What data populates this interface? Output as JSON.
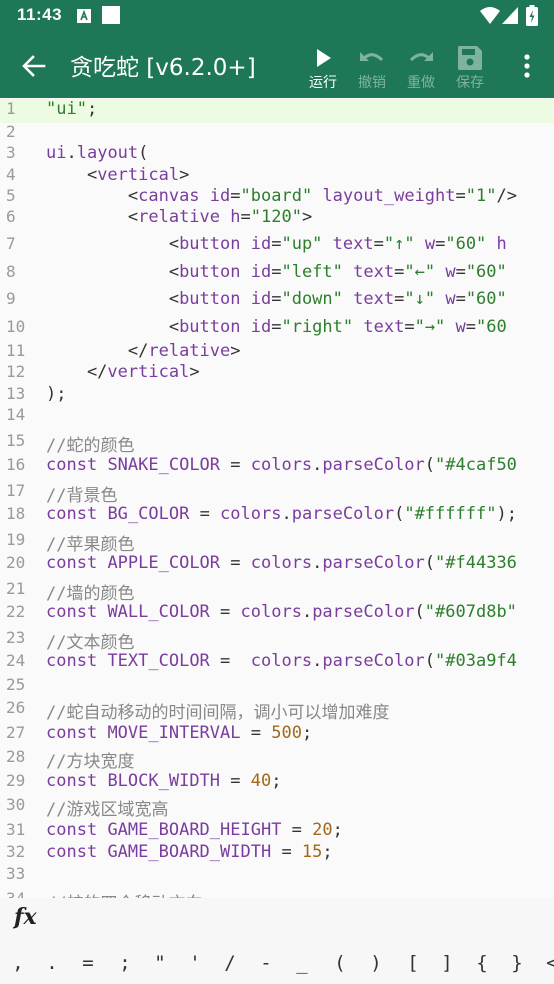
{
  "statusbar": {
    "time": "11:43"
  },
  "toolbar": {
    "title": "贪吃蛇 [v6.2.0+]",
    "run_label": "运行",
    "undo_label": "撤销",
    "redo_label": "重做",
    "save_label": "保存"
  },
  "editor": {
    "lines": [
      {
        "n": "1",
        "t": [
          [
            "s",
            "\"ui\""
          ],
          [
            "p",
            ";"
          ]
        ]
      },
      {
        "n": "2",
        "t": []
      },
      {
        "n": "3",
        "t": [
          [
            "m",
            "ui"
          ],
          [
            "p",
            "."
          ],
          [
            "m",
            "layout"
          ],
          [
            "p",
            "("
          ]
        ]
      },
      {
        "n": "4",
        "t": [
          [
            "p",
            "    <"
          ],
          [
            "k",
            "vertical"
          ],
          [
            "p",
            ">"
          ]
        ]
      },
      {
        "n": "5",
        "t": [
          [
            "p",
            "        <"
          ],
          [
            "k",
            "canvas"
          ],
          [
            "p",
            " "
          ],
          [
            "m",
            "id"
          ],
          [
            "p",
            "="
          ],
          [
            "s",
            "\"board\""
          ],
          [
            "p",
            " "
          ],
          [
            "m",
            "layout_weight"
          ],
          [
            "p",
            "="
          ],
          [
            "s",
            "\"1\""
          ],
          [
            "p",
            "/>"
          ]
        ]
      },
      {
        "n": "6",
        "t": [
          [
            "p",
            "        <"
          ],
          [
            "k",
            "relative"
          ],
          [
            "p",
            " "
          ],
          [
            "m",
            "h"
          ],
          [
            "p",
            "="
          ],
          [
            "s",
            "\"120\""
          ],
          [
            "p",
            ">"
          ]
        ]
      },
      {
        "n": "7",
        "t": [
          [
            "p",
            "            <"
          ],
          [
            "k",
            "button"
          ],
          [
            "p",
            " "
          ],
          [
            "m",
            "id"
          ],
          [
            "p",
            "="
          ],
          [
            "s",
            "\"up\""
          ],
          [
            "p",
            " "
          ],
          [
            "m",
            "text"
          ],
          [
            "p",
            "="
          ],
          [
            "s",
            "\"↑\""
          ],
          [
            "p",
            " "
          ],
          [
            "m",
            "w"
          ],
          [
            "p",
            "="
          ],
          [
            "s",
            "\"60\""
          ],
          [
            "p",
            " "
          ],
          [
            "m",
            "h"
          ]
        ]
      },
      {
        "n": "8",
        "t": [
          [
            "p",
            "            <"
          ],
          [
            "k",
            "button"
          ],
          [
            "p",
            " "
          ],
          [
            "m",
            "id"
          ],
          [
            "p",
            "="
          ],
          [
            "s",
            "\"left\""
          ],
          [
            "p",
            " "
          ],
          [
            "m",
            "text"
          ],
          [
            "p",
            "="
          ],
          [
            "s",
            "\"←\""
          ],
          [
            "p",
            " "
          ],
          [
            "m",
            "w"
          ],
          [
            "p",
            "="
          ],
          [
            "s",
            "\"60\""
          ]
        ]
      },
      {
        "n": "9",
        "t": [
          [
            "p",
            "            <"
          ],
          [
            "k",
            "button"
          ],
          [
            "p",
            " "
          ],
          [
            "m",
            "id"
          ],
          [
            "p",
            "="
          ],
          [
            "s",
            "\"down\""
          ],
          [
            "p",
            " "
          ],
          [
            "m",
            "text"
          ],
          [
            "p",
            "="
          ],
          [
            "s",
            "\"↓\""
          ],
          [
            "p",
            " "
          ],
          [
            "m",
            "w"
          ],
          [
            "p",
            "="
          ],
          [
            "s",
            "\"60\""
          ]
        ]
      },
      {
        "n": "10",
        "t": [
          [
            "p",
            "            <"
          ],
          [
            "k",
            "button"
          ],
          [
            "p",
            " "
          ],
          [
            "m",
            "id"
          ],
          [
            "p",
            "="
          ],
          [
            "s",
            "\"right\""
          ],
          [
            "p",
            " "
          ],
          [
            "m",
            "text"
          ],
          [
            "p",
            "="
          ],
          [
            "s",
            "\"→\""
          ],
          [
            "p",
            " "
          ],
          [
            "m",
            "w"
          ],
          [
            "p",
            "="
          ],
          [
            "s",
            "\"60"
          ]
        ]
      },
      {
        "n": "11",
        "t": [
          [
            "p",
            "        </"
          ],
          [
            "k",
            "relative"
          ],
          [
            "p",
            ">"
          ]
        ]
      },
      {
        "n": "12",
        "t": [
          [
            "p",
            "    </"
          ],
          [
            "k",
            "vertical"
          ],
          [
            "p",
            ">"
          ]
        ]
      },
      {
        "n": "13",
        "t": [
          [
            "p",
            ");"
          ]
        ]
      },
      {
        "n": "14",
        "t": []
      },
      {
        "n": "15",
        "t": [
          [
            "c",
            "//蛇的颜色"
          ]
        ]
      },
      {
        "n": "16",
        "t": [
          [
            "k",
            "const"
          ],
          [
            "p",
            " "
          ],
          [
            "m",
            "SNAKE_COLOR"
          ],
          [
            "p",
            " = "
          ],
          [
            "m",
            "colors"
          ],
          [
            "p",
            "."
          ],
          [
            "m",
            "parseColor"
          ],
          [
            "p",
            "("
          ],
          [
            "s",
            "\"#4caf50"
          ]
        ]
      },
      {
        "n": "17",
        "t": [
          [
            "c",
            "//背景色"
          ]
        ]
      },
      {
        "n": "18",
        "t": [
          [
            "k",
            "const"
          ],
          [
            "p",
            " "
          ],
          [
            "m",
            "BG_COLOR"
          ],
          [
            "p",
            " = "
          ],
          [
            "m",
            "colors"
          ],
          [
            "p",
            "."
          ],
          [
            "m",
            "parseColor"
          ],
          [
            "p",
            "("
          ],
          [
            "s",
            "\"#ffffff\""
          ],
          [
            "p",
            ");"
          ]
        ]
      },
      {
        "n": "19",
        "t": [
          [
            "c",
            "//苹果颜色"
          ]
        ]
      },
      {
        "n": "20",
        "t": [
          [
            "k",
            "const"
          ],
          [
            "p",
            " "
          ],
          [
            "m",
            "APPLE_COLOR"
          ],
          [
            "p",
            " = "
          ],
          [
            "m",
            "colors"
          ],
          [
            "p",
            "."
          ],
          [
            "m",
            "parseColor"
          ],
          [
            "p",
            "("
          ],
          [
            "s",
            "\"#f44336"
          ]
        ]
      },
      {
        "n": "21",
        "t": [
          [
            "c",
            "//墙的颜色"
          ]
        ]
      },
      {
        "n": "22",
        "t": [
          [
            "k",
            "const"
          ],
          [
            "p",
            " "
          ],
          [
            "m",
            "WALL_COLOR"
          ],
          [
            "p",
            " = "
          ],
          [
            "m",
            "colors"
          ],
          [
            "p",
            "."
          ],
          [
            "m",
            "parseColor"
          ],
          [
            "p",
            "("
          ],
          [
            "s",
            "\"#607d8b\""
          ]
        ]
      },
      {
        "n": "23",
        "t": [
          [
            "c",
            "//文本颜色"
          ]
        ]
      },
      {
        "n": "24",
        "t": [
          [
            "k",
            "const"
          ],
          [
            "p",
            " "
          ],
          [
            "m",
            "TEXT_COLOR"
          ],
          [
            "p",
            " =  "
          ],
          [
            "m",
            "colors"
          ],
          [
            "p",
            "."
          ],
          [
            "m",
            "parseColor"
          ],
          [
            "p",
            "("
          ],
          [
            "s",
            "\"#03a9f4"
          ]
        ]
      },
      {
        "n": "25",
        "t": []
      },
      {
        "n": "26",
        "t": [
          [
            "c",
            "//蛇自动移动的时间间隔，调小可以增加难度"
          ]
        ]
      },
      {
        "n": "27",
        "t": [
          [
            "k",
            "const"
          ],
          [
            "p",
            " "
          ],
          [
            "m",
            "MOVE_INTERVAL"
          ],
          [
            "p",
            " = "
          ],
          [
            "n",
            "500"
          ],
          [
            "p",
            ";"
          ]
        ]
      },
      {
        "n": "28",
        "t": [
          [
            "c",
            "//方块宽度"
          ]
        ]
      },
      {
        "n": "29",
        "t": [
          [
            "k",
            "const"
          ],
          [
            "p",
            " "
          ],
          [
            "m",
            "BLOCK_WIDTH"
          ],
          [
            "p",
            " = "
          ],
          [
            "n",
            "40"
          ],
          [
            "p",
            ";"
          ]
        ]
      },
      {
        "n": "30",
        "t": [
          [
            "c",
            "//游戏区域宽高"
          ]
        ]
      },
      {
        "n": "31",
        "t": [
          [
            "k",
            "const"
          ],
          [
            "p",
            " "
          ],
          [
            "m",
            "GAME_BOARD_HEIGHT"
          ],
          [
            "p",
            " = "
          ],
          [
            "n",
            "20"
          ],
          [
            "p",
            ";"
          ]
        ]
      },
      {
        "n": "32",
        "t": [
          [
            "k",
            "const"
          ],
          [
            "p",
            " "
          ],
          [
            "m",
            "GAME_BOARD_WIDTH"
          ],
          [
            "p",
            " = "
          ],
          [
            "n",
            "15"
          ],
          [
            "p",
            ";"
          ]
        ]
      },
      {
        "n": "33",
        "t": []
      },
      {
        "n": "34",
        "t": [
          [
            "c",
            "//蛇的四个移动方向"
          ]
        ]
      }
    ]
  },
  "bottom": {
    "fx_label": "fx",
    "symbols": [
      ",",
      ".",
      "=",
      ";",
      "\"",
      "'",
      "/",
      "-",
      "_",
      "(",
      ")",
      "[",
      "]",
      "{",
      "}",
      "<"
    ]
  }
}
